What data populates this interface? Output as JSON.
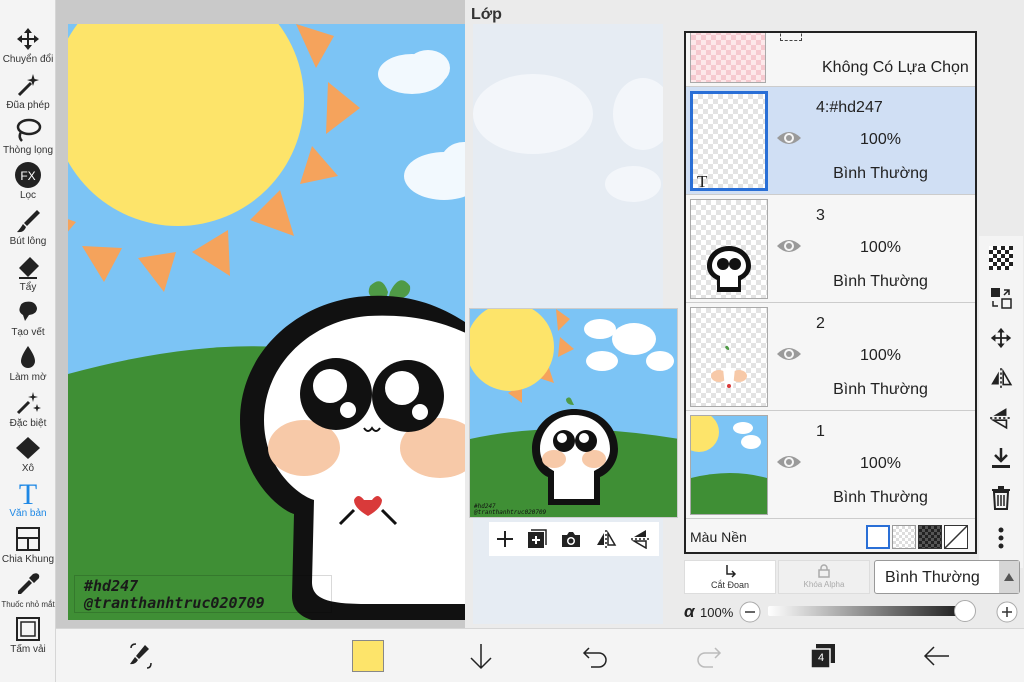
{
  "toolbar": {
    "items": [
      {
        "label": "Chuyển đổi",
        "icon": "move-icon"
      },
      {
        "label": "Đũa phép",
        "icon": "magic-wand-icon"
      },
      {
        "label": "Thòng lọng",
        "icon": "lasso-icon"
      },
      {
        "label": "Lọc",
        "icon": "filter-fx-icon"
      },
      {
        "label": "Bút lông",
        "icon": "brush-icon"
      },
      {
        "label": "Tẩy",
        "icon": "eraser-icon"
      },
      {
        "label": "Tạo vết",
        "icon": "smudge-icon"
      },
      {
        "label": "Làm mờ",
        "icon": "blur-icon"
      },
      {
        "label": "Đặc biệt",
        "icon": "special-icon"
      },
      {
        "label": "Xô",
        "icon": "bucket-icon"
      },
      {
        "label": "Văn bản",
        "icon": "text-icon",
        "active": true
      },
      {
        "label": "Chia Khung",
        "icon": "frame-divider-icon"
      },
      {
        "label": "Thuốc nhỏ mắt",
        "icon": "eyedropper-icon"
      },
      {
        "label": "Tấm vải",
        "icon": "canvas-icon"
      }
    ]
  },
  "canvas": {
    "text_line1": "#hd247",
    "text_line2": "@tranthanhtruc020709"
  },
  "panel": {
    "title": "Lớp",
    "selection_row": "Không Có Lựa Chọn",
    "layers": [
      {
        "name": "4:#hd247",
        "opacity": "100%",
        "mode": "Bình Thường",
        "selected": true
      },
      {
        "name": "3",
        "opacity": "100%",
        "mode": "Bình Thường"
      },
      {
        "name": "2",
        "opacity": "100%",
        "mode": "Bình Thường"
      },
      {
        "name": "1",
        "opacity": "100%",
        "mode": "Bình Thường"
      }
    ],
    "thumb_text1": "#hd247",
    "thumb_text2": "@tranthanhtruc020709",
    "background_label": "Màu Nền",
    "clip_label": "Cắt Đoan",
    "alpha_lock_label": "Khóa Alpha",
    "blend_mode": "Bình Thường",
    "alpha_symbol": "α",
    "alpha_value": "100%",
    "alpha_fraction": 1.0
  },
  "bottombar": {
    "layer_count": "4",
    "current_color": "#fde46a"
  },
  "colors": {
    "accent": "#1e88e5",
    "sky": "#7cc4f5",
    "sun": "#fde46a",
    "grass": "#3f8f35",
    "selection": "#2a6fd6"
  }
}
